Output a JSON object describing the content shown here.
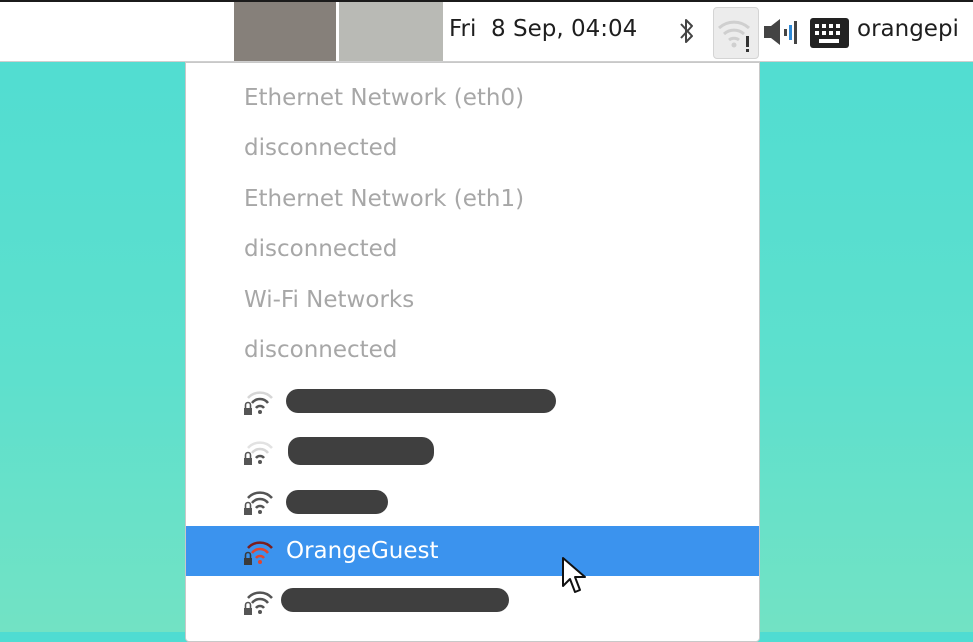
{
  "panel": {
    "clock": "Fri  8 Sep, 04:04",
    "username": "orangepi",
    "icons": [
      "bluetooth-icon",
      "wifi-warning-icon",
      "volume-icon",
      "keyboard-icon"
    ]
  },
  "menu": {
    "headers": [
      "Ethernet Network (eth0)",
      "disconnected",
      "Ethernet Network (eth1)",
      "disconnected",
      "Wi-Fi Networks",
      "disconnected"
    ],
    "networks": [
      {
        "ssid": "",
        "redacted": true,
        "secured": true
      },
      {
        "ssid": "",
        "redacted": true,
        "secured": true
      },
      {
        "ssid": "",
        "redacted": true,
        "secured": true
      },
      {
        "ssid": "OrangeGuest",
        "redacted": false,
        "secured": true,
        "selected": true
      },
      {
        "ssid": "",
        "redacted": true,
        "secured": true
      }
    ]
  },
  "colors": {
    "selection": "#3b93ee",
    "header_text": "#a7a7a7",
    "wifi_active_bars": "#e2452e"
  }
}
